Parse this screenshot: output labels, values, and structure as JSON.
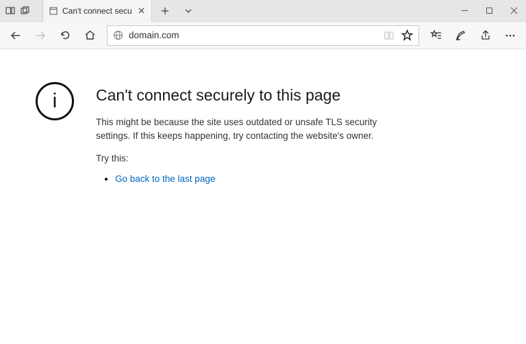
{
  "tab": {
    "title": "Can't connect securely t",
    "icon": "page-icon"
  },
  "url": "domain.com",
  "error": {
    "info_glyph": "i",
    "title": "Can't connect securely to this page",
    "body": "This might be because the site uses outdated or unsafe TLS security settings. If this keeps happening, try contacting the website's owner.",
    "try_label": "Try this:",
    "link_text": "Go back to the last page"
  }
}
